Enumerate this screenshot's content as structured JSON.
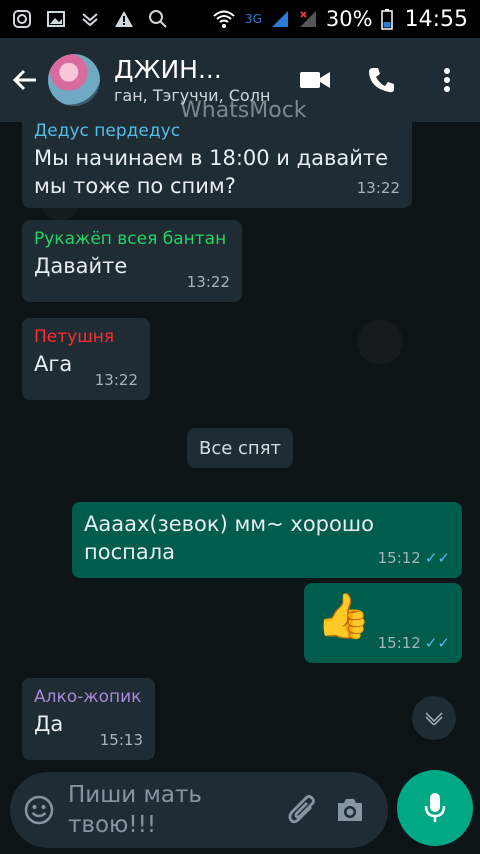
{
  "statusbar": {
    "network": "3G",
    "battery": "30%",
    "time": "14:55"
  },
  "header": {
    "title": "ДЖИН...",
    "subtitle": "ган, Тэгуччи, Солн",
    "watermark": "WhatsMock"
  },
  "messages": [
    {
      "sender": "Дедус пердедус",
      "text": "Мы начинаем в 18:00 и давайте мы тоже по спим?",
      "time": "13:22",
      "sender_color": "#53bdeb"
    },
    {
      "sender": "Рукажёп всея бантан",
      "text": "Давайте",
      "time": "13:22",
      "sender_color": "#25d366"
    },
    {
      "sender": "Петушня",
      "text": "Ага",
      "time": "13:22",
      "sender_color": "#ff2d2d"
    },
    {
      "text": "Ааaax(зевок) мм~ хорошо поспала",
      "time": "15:12",
      "ticks": "✓✓"
    },
    {
      "text": "👍",
      "time": "15:12",
      "ticks": "✓✓"
    },
    {
      "sender": "Алко-жопик",
      "text": "Да",
      "time": "15:13",
      "sender_color": "#a78bda"
    }
  ],
  "system_message": "Все спят",
  "input": {
    "placeholder": "Пиши мать твою!!!"
  }
}
